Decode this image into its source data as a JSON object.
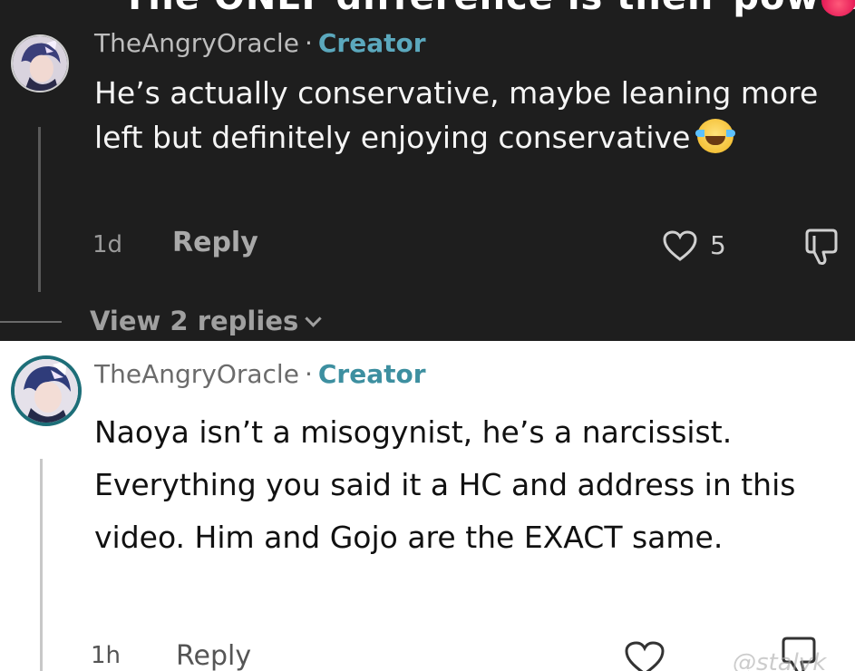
{
  "header_fragment": {
    "text": "The ONLY difference is their powers"
  },
  "comment_1": {
    "username": "TheAngryOracle",
    "separator": "·",
    "role": "Creator",
    "body": "He’s actually conservative, maybe leaning more left but definitely enjoying conservative",
    "emoji": "face-with-tears-of-joy",
    "time": "1d",
    "reply_label": "Reply",
    "likes": "5",
    "view_replies_label": "View 2 replies"
  },
  "comment_2": {
    "username": "TheAngryOracle",
    "separator": "·",
    "role": "Creator",
    "body": "Naoya isn’t a misogynist, he’s a narcissist. Everything you said it a HC and address in this video. Him and Gojo are the EXACT same.",
    "time": "1h",
    "reply_label": "Reply"
  },
  "watermark": "@stalvk",
  "colors": {
    "dark_bg": "#1e1e1e",
    "light_bg": "#ffffff",
    "creator_accent": "#5ba8bd",
    "avatar_ring": "#1d6e78"
  },
  "icons": [
    "avatar-icon",
    "heart-icon",
    "dislike-icon",
    "chevron-down-icon",
    "laughing-emoji-icon"
  ]
}
